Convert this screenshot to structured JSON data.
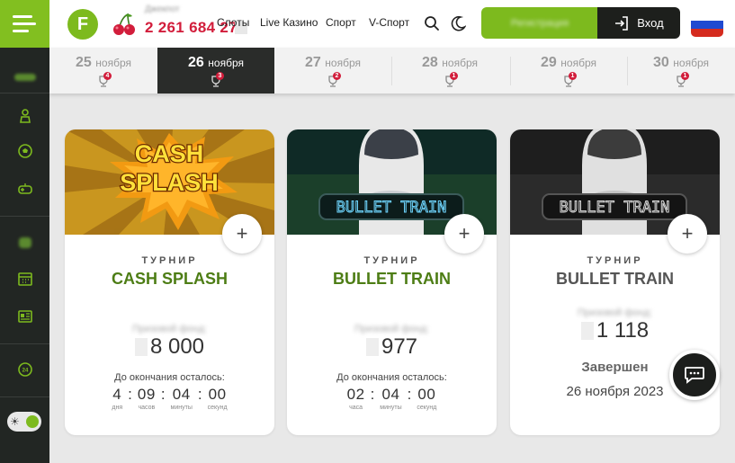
{
  "header": {
    "logo_letter": "F",
    "jackpot_label": "Джекпот",
    "jackpot_value": "2 261 684 277",
    "nav": [
      "Слоты",
      "Live Казино",
      "Спорт",
      "V-Спорт"
    ],
    "register_label": "Регистрация",
    "login_label": "Вход",
    "flag_colors": [
      "#ffffff",
      "#1f4ad1",
      "#d52b1e"
    ]
  },
  "sidebar": {
    "icons": [
      "blurred-item",
      "rank-icon",
      "football-icon",
      "gamepad-icon",
      "blurred-item",
      "calendar-icon",
      "news-icon",
      "support-24-icon"
    ],
    "theme_toggle": "on"
  },
  "dates": [
    {
      "day": "25",
      "month": "ноября",
      "count": "4",
      "active": false
    },
    {
      "day": "26",
      "month": "ноября",
      "count": "3",
      "active": true
    },
    {
      "day": "27",
      "month": "ноября",
      "count": "2",
      "active": false
    },
    {
      "day": "28",
      "month": "ноября",
      "count": "1",
      "active": false
    },
    {
      "day": "29",
      "month": "ноября",
      "count": "1",
      "active": false
    },
    {
      "day": "30",
      "month": "ноября",
      "count": "1",
      "active": false
    }
  ],
  "cards": [
    {
      "kind": "ТУРНИР",
      "name": "CASH SPLASH",
      "image_text_1": "CASH",
      "image_text_2": "SPLASH",
      "fund_label": "Призовой фонд:",
      "fund_value": "8 000",
      "time_left_label": "До окончания осталось:",
      "timer": [
        {
          "value": "4",
          "unit": "дня"
        },
        {
          "value": "09",
          "unit": "часов"
        },
        {
          "value": "04",
          "unit": "минуты"
        },
        {
          "value": "00",
          "unit": "секунд"
        }
      ]
    },
    {
      "kind": "ТУРНИР",
      "name": "BULLET TRAIN",
      "image_text": "BULLET TRAIN",
      "fund_label": "Призовой фонд:",
      "fund_value": "977",
      "time_left_label": "До окончания осталось:",
      "timer": [
        {
          "value": "02",
          "unit": "часа"
        },
        {
          "value": "04",
          "unit": "минуты"
        },
        {
          "value": "00",
          "unit": "секунд"
        }
      ]
    },
    {
      "kind": "ТУРНИР",
      "name": "BULLET TRAIN",
      "image_text": "BULLET TRAIN",
      "fund_label": "Призовой фонд:",
      "fund_value": "1 118",
      "status": "Завершен",
      "end_date": "26 ноября 2023"
    }
  ],
  "colors": {
    "accent": "#7dba1e",
    "accent_dark": "#4d7d15",
    "jackpot": "#d21d3b",
    "sidebar_bg": "#222623"
  }
}
